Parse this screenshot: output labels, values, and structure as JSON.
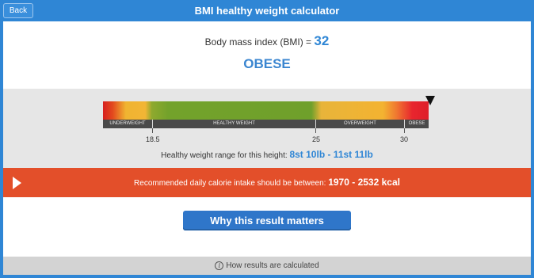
{
  "header": {
    "back_label": "Back",
    "title": "BMI healthy weight calculator"
  },
  "result": {
    "bmi_label": "Body mass index (BMI) = ",
    "bmi_value": "32",
    "category": "OBESE"
  },
  "scale": {
    "segments": [
      "UNDERWEIGHT",
      "HEALTHY WEIGHT",
      "OVERWEIGHT",
      "OBESE"
    ],
    "ticks": [
      "18.5",
      "25",
      "30"
    ],
    "pointer_bmi": 32,
    "range_label": "Healthy weight range for this height: ",
    "range_value": "8st 10lb - 11st 11lb"
  },
  "calorie": {
    "label": "Recommended daily calorie intake should be between: ",
    "value": "1970 - 2532 kcal"
  },
  "why_button": "Why this result matters",
  "footer": {
    "link": "How results are calculated",
    "info_glyph": "i"
  },
  "colors": {
    "brand": "#2f86d5",
    "alert": "#e34f2a",
    "button": "#2f76c9"
  }
}
